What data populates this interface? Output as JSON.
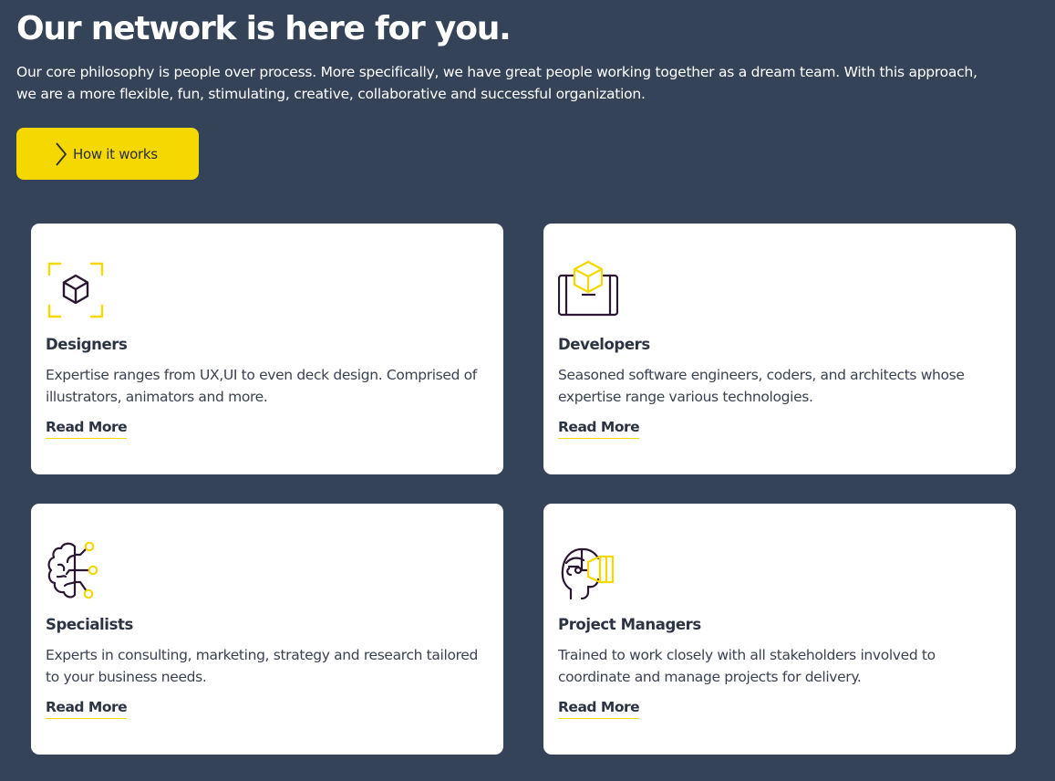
{
  "hero": {
    "title": "Our network is here for you.",
    "description": "Our core philosophy is people over process. More specifically, we have great people working together as a dream team. With this approach, we are a more flexible, fun, stimulating, creative, collaborative and successful organization.",
    "cta_label": "How it works"
  },
  "cards": [
    {
      "icon": "cube-frame-icon",
      "title": "Designers",
      "description": "Expertise ranges from UX,UI to even deck design. Comprised of illustrators, animators and more.",
      "link": "Read More"
    },
    {
      "icon": "device-cube-icon",
      "title": "Developers",
      "description": "Seasoned software engineers, coders, and architects whose expertise range various technologies.",
      "link": "Read More"
    },
    {
      "icon": "brain-circuit-icon",
      "title": "Specialists",
      "description": "Experts in consulting, marketing, strategy and research tailored to your business needs.",
      "link": "Read More"
    },
    {
      "icon": "head-vision-icon",
      "title": "Project Managers",
      "description": "Trained to work closely with all stakeholders involved to coordinate and manage projects for delivery.",
      "link": "Read More"
    }
  ],
  "colors": {
    "background": "#344357",
    "accent": "#f5d800",
    "card": "#ffffff",
    "text_dark": "#2c3444",
    "icon_dark": "#2a1633"
  }
}
